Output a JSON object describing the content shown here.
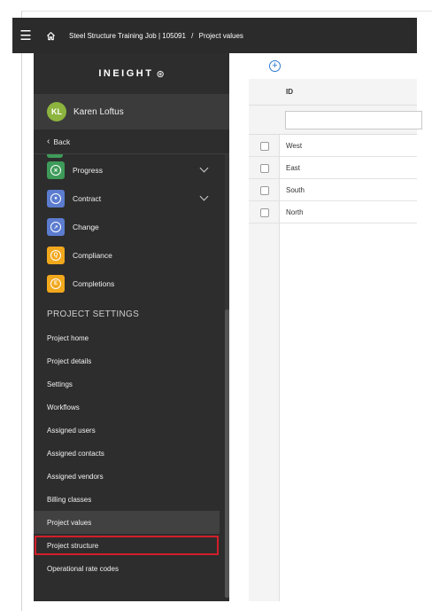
{
  "topbar": {
    "menu_icon": "hamburger-icon",
    "home_icon": "home-icon",
    "breadcrumb_job": "Steel Structure Training Job | 105091",
    "breadcrumb_sep": "/",
    "breadcrumb_page": "Project values"
  },
  "sidebar": {
    "logo_text": "INEIGHT",
    "logo_mark": "⊛",
    "user": {
      "initials": "KL",
      "name": "Karen Loftus",
      "avatar_color": "#8cb43e"
    },
    "back_label": "Back",
    "modules": [
      {
        "label": "Progress",
        "icon": "progress-icon",
        "color": "#3e9b59",
        "glyph": "✕",
        "expandable": true
      },
      {
        "label": "Contract",
        "icon": "contract-icon",
        "color": "#5b7ccf",
        "glyph": "●",
        "expandable": true
      },
      {
        "label": "Change",
        "icon": "change-icon",
        "color": "#5b7ccf",
        "glyph": "↗",
        "expandable": false
      },
      {
        "label": "Compliance",
        "icon": "compliance-icon",
        "color": "#f2a81d",
        "glyph": "Q",
        "expandable": false
      },
      {
        "label": "Completions",
        "icon": "completions-icon",
        "color": "#f2a81d",
        "glyph": "E",
        "expandable": false
      }
    ],
    "section_title": "PROJECT SETTINGS",
    "settings": [
      "Project home",
      "Project details",
      "Settings",
      "Workflows",
      "Assigned users",
      "Assigned contacts",
      "Assigned vendors",
      "Billing classes",
      "Project values",
      "Project structure",
      "Operational rate codes"
    ],
    "active_setting": "Project values",
    "highlighted_setting": "Project structure",
    "highlight_color": "#d21f2a"
  },
  "grid": {
    "add_icon": "add-circle-icon",
    "column_header": "ID",
    "filter_placeholder": "",
    "rows": [
      "West",
      "East",
      "South",
      "North"
    ]
  }
}
